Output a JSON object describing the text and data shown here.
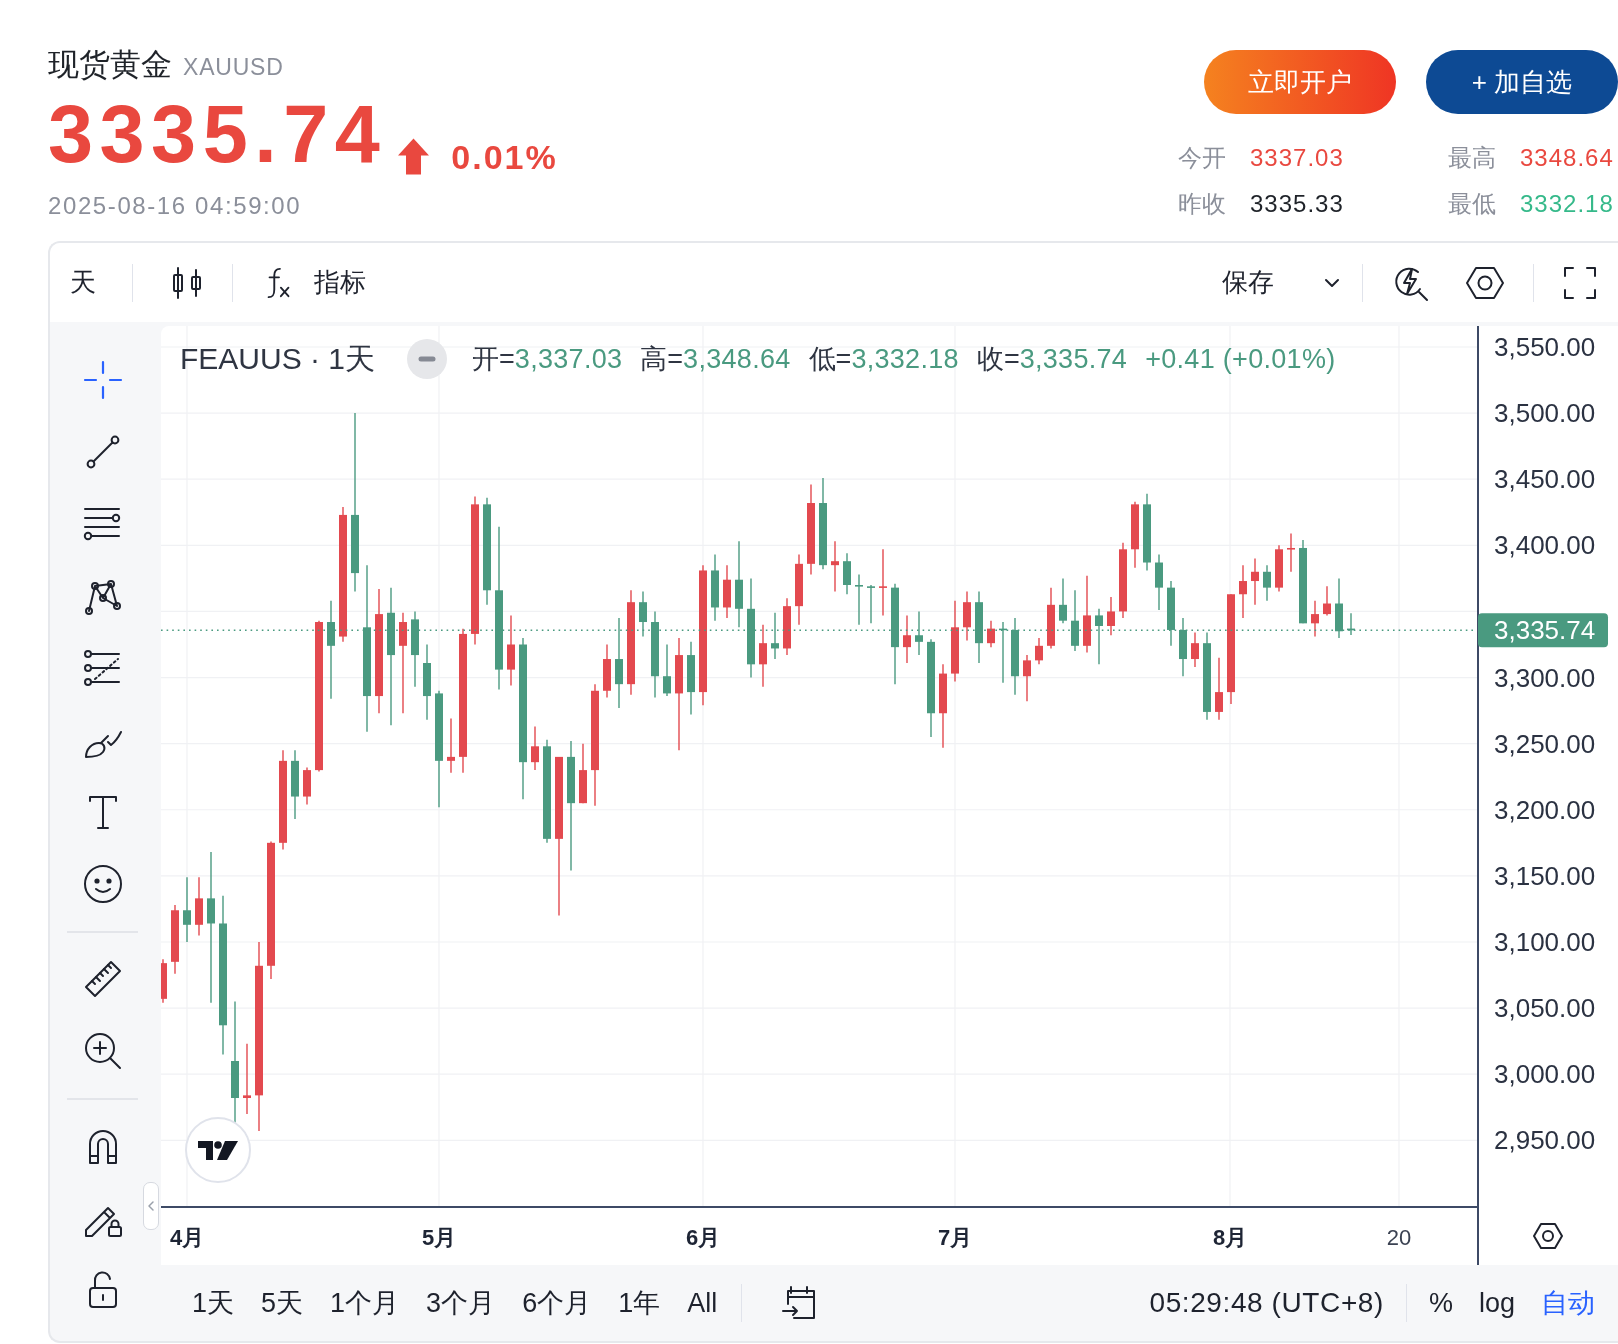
{
  "quote": {
    "name": "现货黄金",
    "symbol": "XAUUSD",
    "price": "3335.74",
    "change": "0.01%",
    "rising": true,
    "time": "2025-08-16 04:59:00"
  },
  "actions": [
    {
      "label": "立即开户",
      "kind": "open-account"
    },
    {
      "label": "+ 加自选",
      "kind": "watchlist"
    }
  ],
  "stats": [
    {
      "label": "今开",
      "value": "3337.03",
      "color": "#e9483f"
    },
    {
      "label": "最高",
      "value": "3348.64",
      "color": "#e9483f"
    },
    {
      "label": "昨收",
      "value": "3335.33",
      "color": "#1f2329"
    },
    {
      "label": "最低",
      "value": "3332.18",
      "color": "#35b98a"
    }
  ],
  "toolbar": {
    "interval": "天",
    "indicators": "指标",
    "save": "保存"
  },
  "tool_groups": [
    [
      {
        "selected": true
      },
      {
        "selected": false
      },
      {
        "selected": false
      },
      {
        "selected": false
      },
      {
        "selected": false
      },
      {
        "selected": false
      },
      {
        "selected": false
      },
      {
        "selected": false
      }
    ],
    [
      {
        "selected": false
      },
      {
        "selected": false
      }
    ],
    [
      {
        "selected": false
      },
      {
        "selected": false
      },
      {
        "selected": false
      }
    ]
  ],
  "chart": {
    "title": "FEAUUS · 1天",
    "legend": [
      {
        "label": "开=",
        "value": "3,337.03"
      },
      {
        "label": "高=",
        "value": "3,348.64"
      },
      {
        "label": "低=",
        "value": "3,332.18"
      },
      {
        "label": "收=",
        "value": "3,335.74"
      }
    ],
    "change": "+0.41 (+0.01%)",
    "rising": false
  },
  "price_axis": {
    "upper_ticks": [
      "3,550.00",
      "3,500.00",
      "3,450.00",
      "3,400.00"
    ],
    "lower_ticks": [
      "3,300.00",
      "3,250.00",
      "3,200.00",
      "3,150.00",
      "3,100.00",
      "3,050.00",
      "3,000.00",
      "2,950.00"
    ],
    "last_price": "3,335.74"
  },
  "time_axis": [
    {
      "label": "4月",
      "kind": "month"
    },
    {
      "label": "5月",
      "kind": "month"
    },
    {
      "label": "6月",
      "kind": "month"
    },
    {
      "label": "7月",
      "kind": "month"
    },
    {
      "label": "8月",
      "kind": "month"
    },
    {
      "label": "20",
      "kind": "day"
    }
  ],
  "ranges": [
    {
      "label": "1天",
      "selected": false
    },
    {
      "label": "5天",
      "selected": false
    },
    {
      "label": "1个月",
      "selected": false
    },
    {
      "label": "3个月",
      "selected": false
    },
    {
      "label": "6个月",
      "selected": false
    },
    {
      "label": "1年",
      "selected": false
    },
    {
      "label": "All",
      "selected": false
    }
  ],
  "clock": "05:29:48 (UTC+8)",
  "scale_modes": [
    {
      "label": "%",
      "selected": false
    },
    {
      "label": "log",
      "selected": false
    },
    {
      "label": "自动",
      "selected": true
    }
  ]
}
